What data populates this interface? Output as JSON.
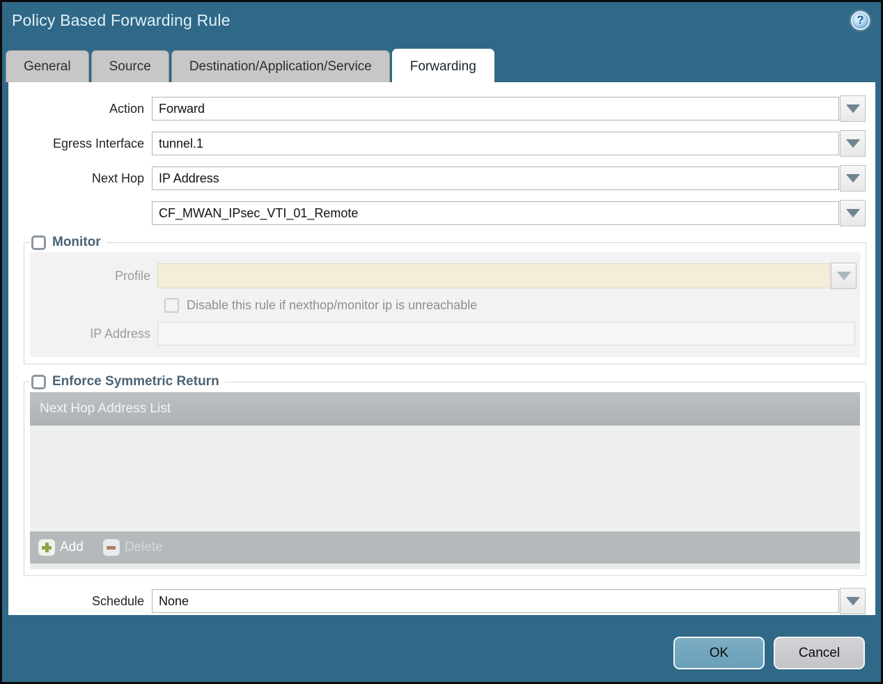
{
  "dialog": {
    "title": "Policy Based Forwarding Rule",
    "help_icon_glyph": "?"
  },
  "tabs": [
    {
      "label": "General",
      "active": false
    },
    {
      "label": "Source",
      "active": false
    },
    {
      "label": "Destination/Application/Service",
      "active": false
    },
    {
      "label": "Forwarding",
      "active": true
    }
  ],
  "form": {
    "action": {
      "label": "Action",
      "value": "Forward"
    },
    "egress_interface": {
      "label": "Egress Interface",
      "value": "tunnel.1"
    },
    "next_hop": {
      "label": "Next Hop",
      "value": "IP Address"
    },
    "next_hop_address": {
      "value": "CF_MWAN_IPsec_VTI_01_Remote"
    },
    "schedule": {
      "label": "Schedule",
      "value": "None"
    }
  },
  "monitor": {
    "label": "Monitor",
    "checked": false,
    "profile": {
      "label": "Profile",
      "value": ""
    },
    "disable_rule_checkbox": {
      "label": "Disable this rule if nexthop/monitor ip is unreachable",
      "checked": false
    },
    "ip_address": {
      "label": "IP Address",
      "value": ""
    }
  },
  "enforce_symmetric_return": {
    "label": "Enforce Symmetric Return",
    "checked": false,
    "table": {
      "header": "Next Hop Address List",
      "rows": [],
      "add_label": "Add",
      "delete_label": "Delete"
    }
  },
  "footer": {
    "ok_label": "OK",
    "cancel_label": "Cancel"
  },
  "colors": {
    "frame_teal": "#306887",
    "title_text": "#e3f1f7",
    "tab_inactive_bg": "#c7c7c8",
    "active_tab_bg": "#ffffff",
    "group_label_text": "#4b6375",
    "disabled_field_cream": "#f4edda",
    "table_header_bg": "#b2b7b9",
    "table_body_bg": "#eef0f0",
    "add_plus_green": "#8ca442",
    "delete_minus_red": "#b17b68",
    "ok_button_bg": "#6fa4bd",
    "cancel_button_bg": "#c9cacd"
  }
}
